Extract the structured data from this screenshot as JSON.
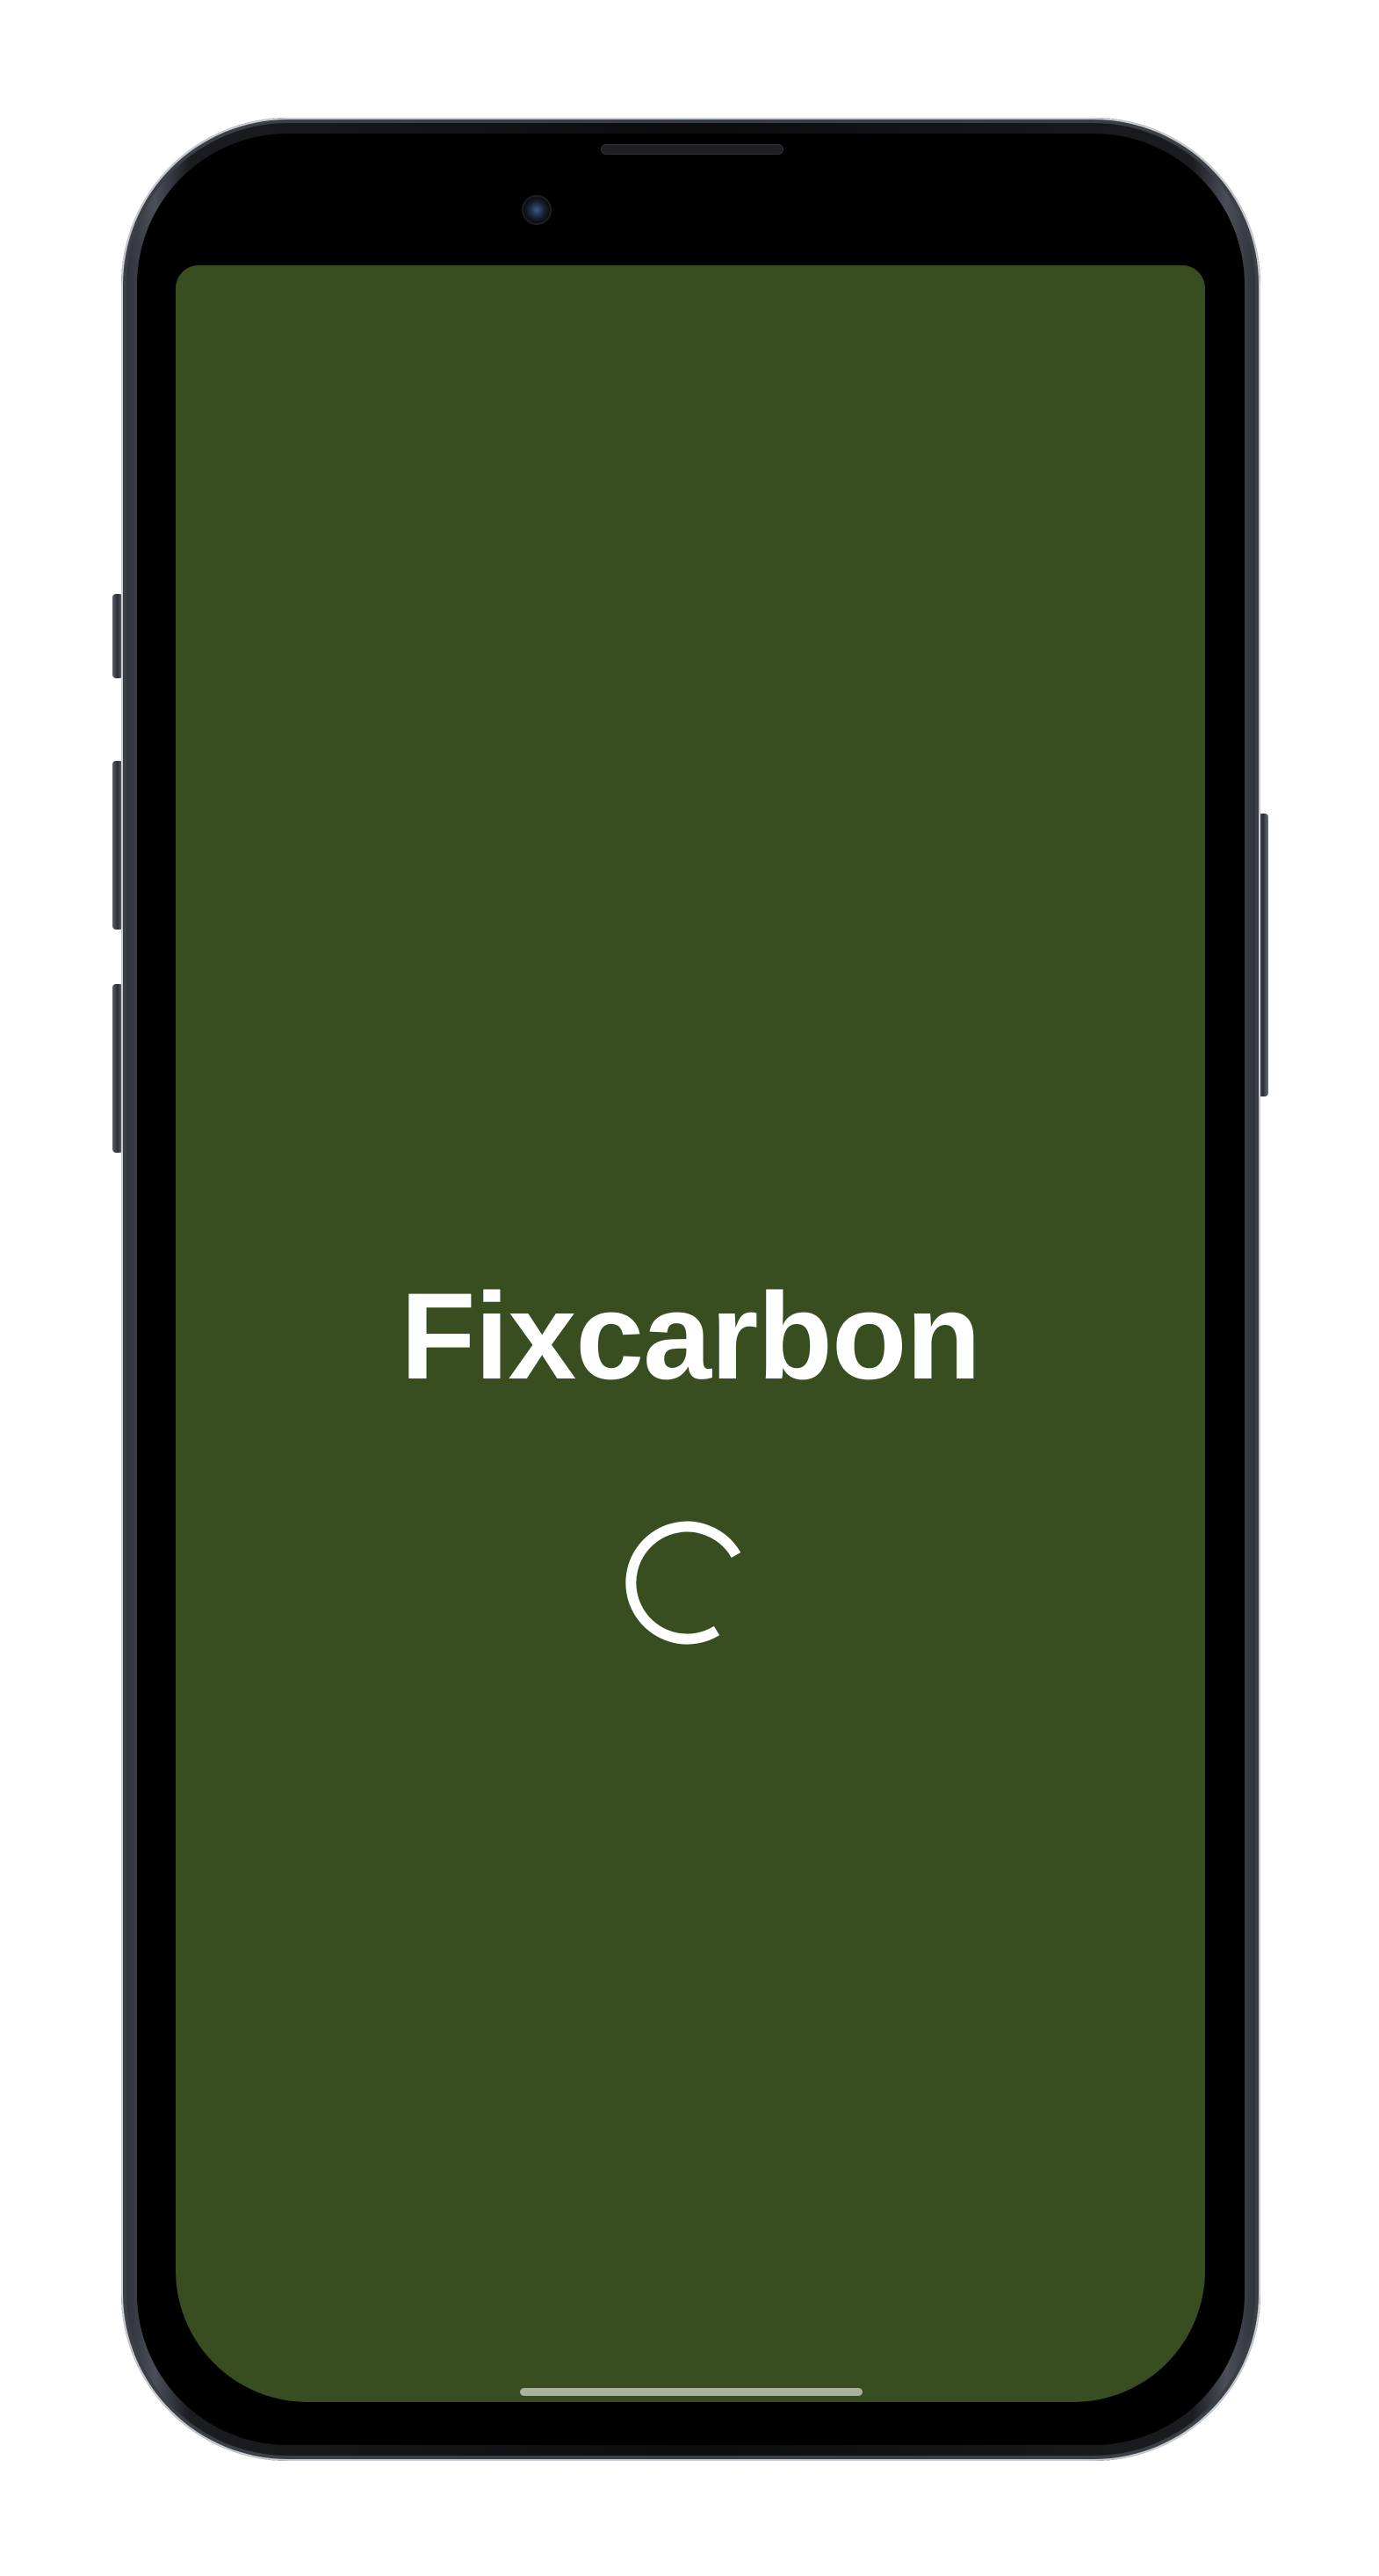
{
  "app": {
    "title": "Fixcarbon"
  },
  "loading_indicator": {
    "icon": "loading-spinner-icon",
    "state": "loading"
  },
  "colors": {
    "screen_background": "#384d20",
    "title_text": "#ffffff",
    "spinner": "#ffffff",
    "home_indicator": "#a8b39a"
  }
}
